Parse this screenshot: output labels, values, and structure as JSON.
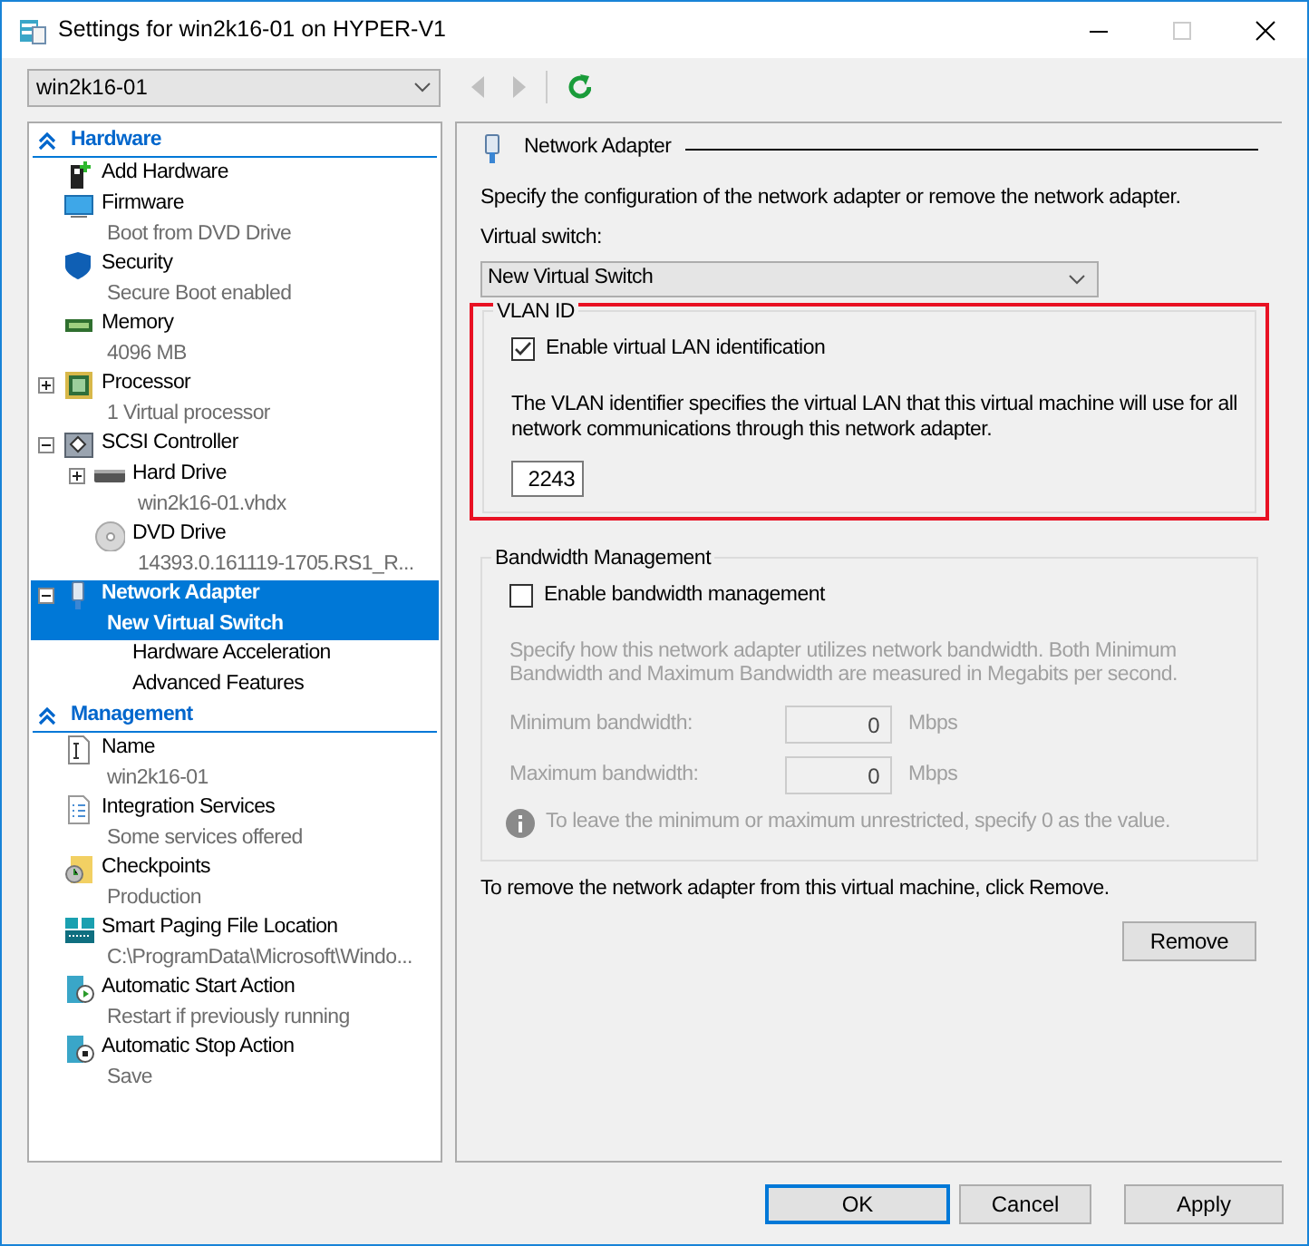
{
  "window": {
    "title": "Settings for win2k16-01 on HYPER-V1"
  },
  "vm_selector": {
    "value": "win2k16-01"
  },
  "nav_buttons": [
    {
      "kind": "back",
      "disabled": true
    },
    {
      "kind": "forward",
      "disabled": true
    },
    {
      "kind": "refresh",
      "disabled": false
    }
  ],
  "tree": {
    "sections": [
      {
        "title": "Hardware",
        "expanded": true,
        "items": [
          {
            "label": "Add Hardware",
            "selected": false
          },
          {
            "label": "Firmware",
            "detail": "Boot from DVD Drive",
            "selected": false
          },
          {
            "label": "Security",
            "detail": "Secure Boot enabled",
            "selected": false
          },
          {
            "label": "Memory",
            "detail": "4096 MB",
            "selected": false
          },
          {
            "label": "Processor",
            "detail": "1 Virtual processor",
            "selected": false,
            "expanded": false
          },
          {
            "label": "SCSI Controller",
            "selected": false,
            "expanded": true,
            "children": [
              {
                "label": "Hard Drive",
                "detail": "win2k16-01.vhdx",
                "selected": false,
                "expanded": false
              },
              {
                "label": "DVD Drive",
                "detail": "14393.0.161119-1705.RS1_R...",
                "selected": false
              }
            ]
          },
          {
            "label": "Network Adapter",
            "detail": "New Virtual Switch",
            "selected": true,
            "expanded": true,
            "children": [
              {
                "label": "Hardware Acceleration",
                "selected": false
              },
              {
                "label": "Advanced Features",
                "selected": false
              }
            ]
          }
        ]
      },
      {
        "title": "Management",
        "expanded": true,
        "items": [
          {
            "label": "Name",
            "detail": "win2k16-01",
            "selected": false
          },
          {
            "label": "Integration Services",
            "detail": "Some services offered",
            "selected": false
          },
          {
            "label": "Checkpoints",
            "detail": "Production",
            "selected": false
          },
          {
            "label": "Smart Paging File Location",
            "detail": "C:\\ProgramData\\Microsoft\\Windo...",
            "selected": false
          },
          {
            "label": "Automatic Start Action",
            "detail": "Restart if previously running",
            "selected": false
          },
          {
            "label": "Automatic Stop Action",
            "detail": "Save",
            "selected": false
          }
        ]
      }
    ]
  },
  "panel": {
    "title": "Network Adapter",
    "description": "Specify the configuration of the network adapter or remove the network adapter.",
    "switch_label": "Virtual switch:",
    "switch_value": "New Virtual Switch",
    "vlan": {
      "legend": "VLAN ID",
      "highlighted": true,
      "enable": {
        "label": "Enable virtual LAN identification",
        "checked": true
      },
      "description": "The VLAN identifier specifies the virtual LAN that this virtual machine will use for all network communications through this network adapter.",
      "value": "2243"
    },
    "bandwidth": {
      "legend": "Bandwidth Management",
      "enable": {
        "label": "Enable bandwidth management",
        "checked": false
      },
      "description": "Specify how this network adapter utilizes network bandwidth. Both Minimum Bandwidth and Maximum Bandwidth are measured in Megabits per second.",
      "fields": [
        {
          "label": "Minimum bandwidth:",
          "value": "0",
          "unit": "Mbps"
        },
        {
          "label": "Maximum bandwidth:",
          "value": "0",
          "unit": "Mbps"
        }
      ],
      "note": "To leave the minimum or maximum unrestricted, specify 0 as the value."
    },
    "remove_text": "To remove the network adapter from this virtual machine, click Remove.",
    "remove_button": "Remove"
  },
  "buttons": [
    {
      "label": "OK",
      "default": true
    },
    {
      "label": "Cancel",
      "default": false
    },
    {
      "label": "Apply",
      "default": false
    }
  ]
}
